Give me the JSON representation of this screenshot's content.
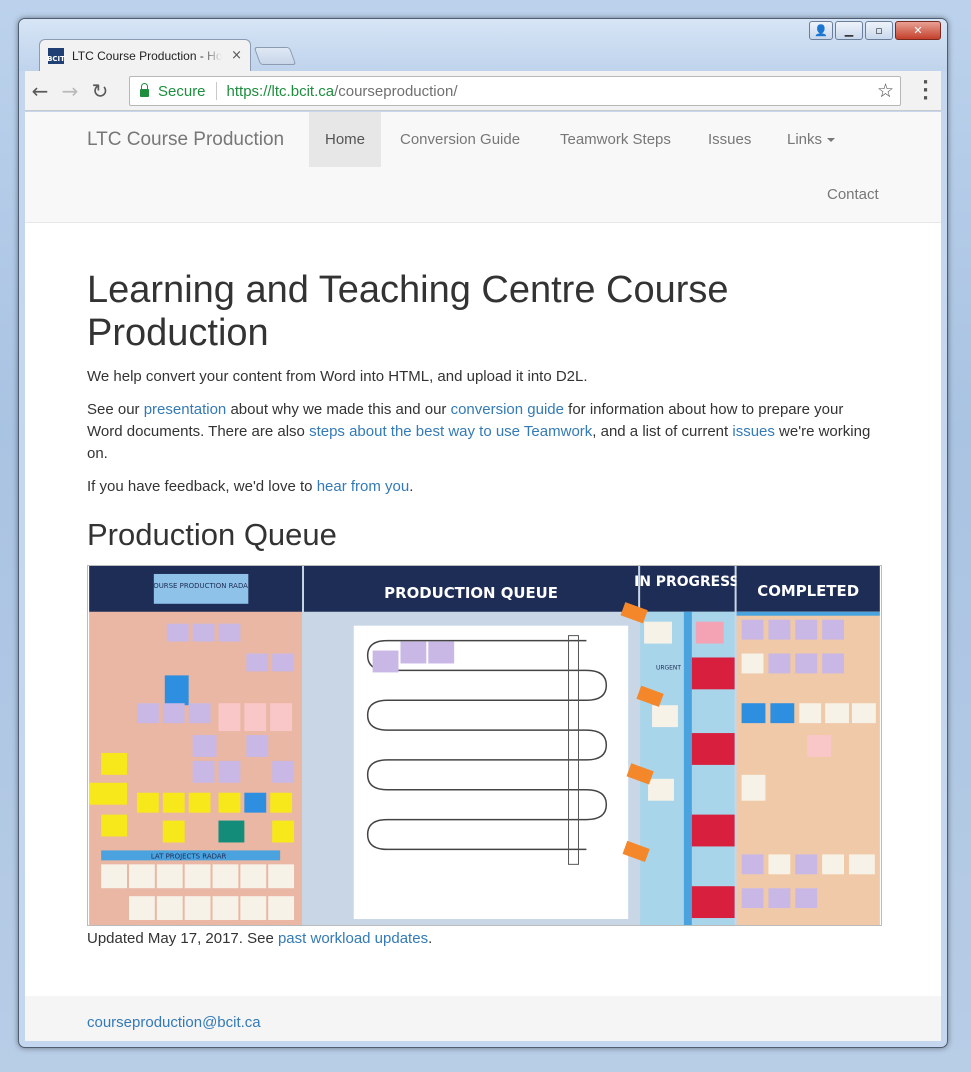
{
  "browser": {
    "tab_title": "LTC Course Production - Home",
    "favicon_text": "BCIT",
    "tab_close": "×",
    "secure_label": "Secure",
    "url_scheme_host": "https://ltc.bcit.ca",
    "url_path": "/courseproduction/",
    "icons": [
      "back-arrow-icon",
      "forward-arrow-icon",
      "reload-icon",
      "lock-icon",
      "star-icon",
      "menu-icon"
    ]
  },
  "window": {
    "buttons": [
      "user-icon",
      "minimize-icon",
      "maximize-icon",
      "close-icon"
    ]
  },
  "site": {
    "brand": "LTC Course Production",
    "nav": [
      {
        "label": "Home",
        "active": true
      },
      {
        "label": "Conversion Guide"
      },
      {
        "label": "Teamwork Steps"
      },
      {
        "label": "Issues"
      },
      {
        "label": "Links"
      },
      {
        "label": "Contact"
      }
    ]
  },
  "main": {
    "title": "Learning and Teaching Centre Course Production",
    "intro": "We help convert your content from Word into HTML, and upload it into D2L.",
    "p2": {
      "t1": "See our ",
      "link_presentation": "presentation",
      "t2": " about why we made this and our ",
      "link_conversion": "conversion guide",
      "t3": " for information about how to prepare your Word documents. There are also ",
      "link_steps": "steps about the best way to use Teamwork",
      "t4": ", and a list of current ",
      "link_issues": "issues",
      "t5": " we're working on."
    },
    "p3": {
      "t1": "If you have feedback, we'd love to ",
      "link_contact": "hear from you",
      "t2": "."
    },
    "queue_heading": "Production Queue",
    "board": {
      "headers": [
        "COURSE PRODUCTION RADAR",
        "PRODUCTION QUEUE",
        "IN PROGRESS",
        "COMPLETED"
      ],
      "lane_label": "URGENT",
      "radar_label": "LAT PROJECTS RADAR",
      "colors": {
        "header": "#1e2d55",
        "radar_bg": "#e9b7a3",
        "queue_bg": "#c8d6e6",
        "progress_bg": "#a8d5ea",
        "completed_bg": "#f0c9a8",
        "red_block": "#d81f3d"
      }
    },
    "caption": {
      "t1": "Updated May 17, 2017. See ",
      "link_updates": "past workload updates",
      "t2": "."
    }
  },
  "footer": {
    "email": "courseproduction@bcit.ca"
  }
}
